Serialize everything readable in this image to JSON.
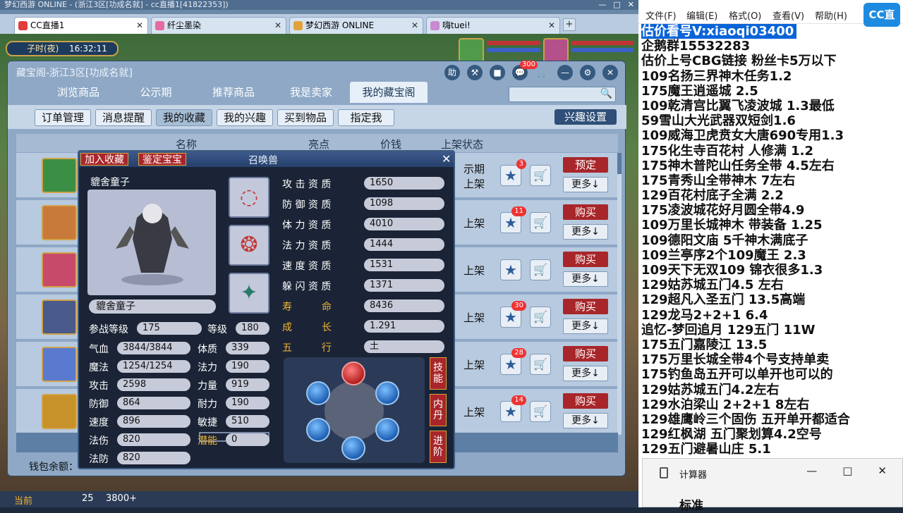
{
  "window": {
    "title": "梦幻西游 ONLINE - (浙江3区[功成名就] - cc直播1[41822353])",
    "buttons": [
      "—",
      "□",
      "✕"
    ]
  },
  "browser_tabs": [
    {
      "label": "CC直播1",
      "close": "✕"
    },
    {
      "label": "纤尘墨染",
      "close": "✕"
    },
    {
      "label": "梦幻西游 ONLINE",
      "close": "✕"
    },
    {
      "label": "嗨tuei!",
      "close": "✕"
    }
  ],
  "new_tab": "+",
  "game": {
    "clock_label": "子时(夜)",
    "clock_time": "16:32:11"
  },
  "dialog": {
    "title": "藏宝阁-浙江3区[功成名就]",
    "icons": {
      "help": "助",
      "hammer": "⚒",
      "stop": "■",
      "chat": "💬",
      "chat_badge": "300",
      "cart": "🛒",
      "min": "—",
      "settings": "⚙",
      "close": "✕"
    },
    "nav_tabs": [
      "浏览商品",
      "公示期",
      "推荐商品",
      "我是卖家",
      "我的藏宝阁"
    ],
    "sub_tabs": [
      "订单管理",
      "消息提醒",
      "我的收藏",
      "我的兴趣",
      "买到物品",
      "指定我"
    ],
    "interest_button": "兴趣设置",
    "search_icon": "🔍",
    "table_headers": {
      "name": "名称",
      "highlight": "亮点",
      "price": "价钱",
      "status": "上架状态"
    },
    "rows": [
      {
        "status": "示期\n上架",
        "star_count": "3",
        "action": "预定",
        "more": "更多↓",
        "color": "#3b8f45"
      },
      {
        "status": "上架",
        "star_count": "11",
        "action": "购买",
        "more": "更多↓",
        "color": "#c87a3a"
      },
      {
        "status": "上架",
        "star_count": "",
        "action": "购买",
        "more": "更多↓",
        "color": "#c84a6a"
      },
      {
        "status": "上架",
        "star_count": "30",
        "action": "购买",
        "more": "更多↓",
        "color": "#4a5a8a"
      },
      {
        "status": "上架",
        "star_count": "28",
        "action": "购买",
        "more": "更多↓",
        "color": "#5a7ad0"
      },
      {
        "status": "上架",
        "star_count": "14",
        "action": "购买",
        "more": "更多↓",
        "color": "#c8922a"
      }
    ],
    "wallet_label": "钱包余额："
  },
  "pet": {
    "btn_fav": "加入收藏",
    "btn_appraise": "鉴定宝宝",
    "title": "召唤兽",
    "close": "✕",
    "name": "貔舍童子",
    "name_box": "貔舍童子",
    "level_label": "参战等级",
    "level_value": "175",
    "grade_label": "等级",
    "grade_value": "180",
    "stats_left": [
      {
        "label": "气血",
        "value": "3844/3844"
      },
      {
        "label": "魔法",
        "value": "1254/1254"
      },
      {
        "label": "攻击",
        "value": "2598"
      },
      {
        "label": "防御",
        "value": "864"
      },
      {
        "label": "速度",
        "value": "896"
      },
      {
        "label": "法伤",
        "value": "820"
      },
      {
        "label": "法防",
        "value": "820"
      }
    ],
    "stats_mid": [
      {
        "label": "体质",
        "value": "339"
      },
      {
        "label": "法力",
        "value": "190"
      },
      {
        "label": "力量",
        "value": "919"
      },
      {
        "label": "耐力",
        "value": "190"
      },
      {
        "label": "敏捷",
        "value": "510"
      },
      {
        "label": "潜能",
        "value": "0"
      }
    ],
    "aptitudes": [
      {
        "label": "攻 击 资 质",
        "value": "1650"
      },
      {
        "label": "防 御 资 质",
        "value": "1098"
      },
      {
        "label": "体 力 资 质",
        "value": "4010"
      },
      {
        "label": "法 力 资 质",
        "value": "1444"
      },
      {
        "label": "速 度 资 质",
        "value": "1531"
      },
      {
        "label": "躲 闪 资 质",
        "value": "1371"
      },
      {
        "label": "寿　　　命",
        "value": "8436"
      },
      {
        "label": "成　　　长",
        "value": "1.291"
      },
      {
        "label": "五　　　行",
        "value": "土"
      }
    ],
    "side_buttons": [
      "技能",
      "内丹",
      "进阶"
    ]
  },
  "game_task": {
    "left": "当前",
    "count": "25",
    "money": "3800+"
  },
  "notepad": {
    "menu": [
      "文件(F)",
      "编辑(E)",
      "格式(O)",
      "查看(V)",
      "帮助(H)"
    ],
    "lines": [
      "估价看号V:xiaoqi03400",
      "企鹅群15532283",
      "估价上号CBG链接 粉丝卡5万以下",
      "109名扬三界神木任务1.2",
      "175魔王逍遥城 2.5",
      "109乾清宫比翼飞凌波城 1.3最低",
      "59雪山大光武器双短剑1.6",
      "109威海卫虎贲女大唐690专用1.3",
      "175化生寺百花村 人修满 1.2",
      "175神木普陀山任务全带 4.5左右",
      "175青秀山全带神木  7左右",
      "129百花村底子全满 2.2",
      "175凌波城花好月圆全带4.9",
      "109万里长城神木 带装备  1.25",
      "109德阳文庙 5千神木满底子",
      "109兰亭序2个109魔王 2.3",
      "109天下无双109  锦衣很多1.3",
      "129姑苏城五门4.5 左右",
      "129超凡入圣五门  13.5高端",
      "129龙马2+2+1  6.4",
      "追忆-梦回追月 129五门 11W",
      "175五门嘉陵江 13.5",
      "175万里长城全带4个号支持单卖",
      "175钓鱼岛五开可以单开也可以的",
      "129姑苏城五门4.2左右",
      "129水泊梁山 2+2+1 8左右",
      "129雄鹰岭三个固伤 五开单开都适合",
      "129红枫湖 五门聚划算4.2空号",
      "129五门避暑山庄  5.1"
    ]
  },
  "cc_logo": "CC直播",
  "calculator": {
    "title": "计算器",
    "mode": "标准",
    "controls": [
      "—",
      "□",
      "✕"
    ]
  }
}
